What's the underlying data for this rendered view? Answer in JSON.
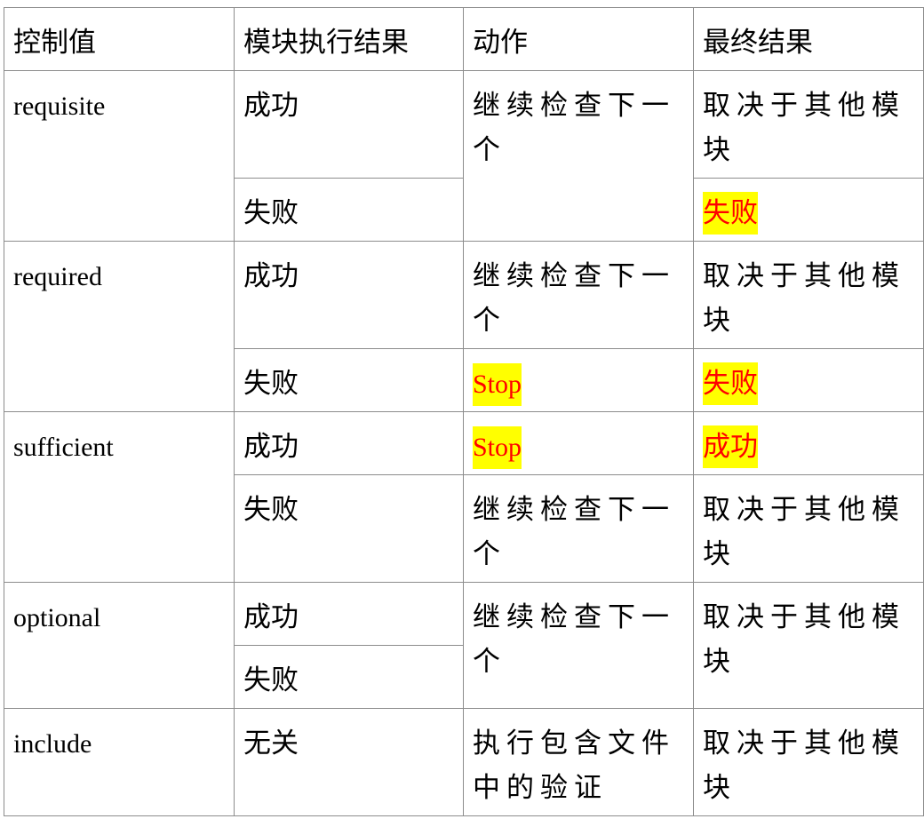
{
  "table": {
    "headers": [
      "控制值",
      "模块执行结果",
      "动作",
      "最终结果"
    ],
    "groups": [
      {
        "control": "requisite",
        "rows": [
          {
            "result": "成功",
            "action": "继续检查下一个",
            "final": "取决于其他模块"
          },
          {
            "result": "失败",
            "final": "失败",
            "final_highlighted": true
          }
        ],
        "action_merged": true
      },
      {
        "control": "required",
        "rows": [
          {
            "result": "成功",
            "action": "继续检查下一个",
            "final": "取决于其他模块"
          },
          {
            "result": "失败",
            "action": "Stop",
            "action_highlighted": true,
            "final": "失败",
            "final_highlighted": true
          }
        ]
      },
      {
        "control": "sufficient",
        "rows": [
          {
            "result": "成功",
            "action": "Stop",
            "action_highlighted": true,
            "final": "成功",
            "final_highlighted": true
          },
          {
            "result": "失败",
            "action": "继续检查下一个",
            "final": "取决于其他模块"
          }
        ]
      },
      {
        "control": "optional",
        "rows": [
          {
            "result": "成功",
            "action": "继续检查下一个",
            "final": "取决于其他模块"
          },
          {
            "result": "失败"
          }
        ],
        "action_merged": true,
        "final_merged": true
      },
      {
        "control": "include",
        "rows": [
          {
            "result": "无关",
            "action": "执行包含文件中的验证",
            "final": "取决于其他模块"
          }
        ]
      }
    ]
  },
  "colors": {
    "highlight_bg": "#ffff00",
    "highlight_text": "#ff0000",
    "border": "#8c8c8c"
  }
}
